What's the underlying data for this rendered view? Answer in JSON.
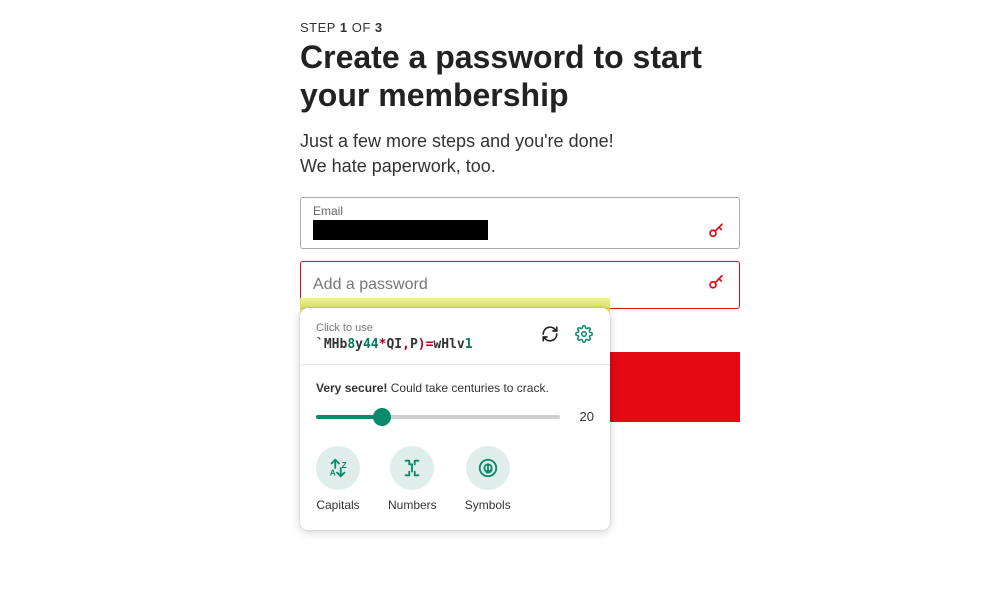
{
  "step": {
    "prefix": "STEP",
    "current": "1",
    "of_word": "OF",
    "total": "3"
  },
  "title_line1": "Create a password to start",
  "title_line2": "your membership",
  "subtitle_line1": "Just a few more steps and you're done!",
  "subtitle_line2": "We hate paperwork, too.",
  "email": {
    "label": "Email"
  },
  "password": {
    "placeholder": "Add a password"
  },
  "generator": {
    "click_label": "Click to use",
    "chars": [
      {
        "c": "`",
        "cls": "c-dk"
      },
      {
        "c": "M",
        "cls": "c-dk"
      },
      {
        "c": "H",
        "cls": "c-dk"
      },
      {
        "c": "b",
        "cls": "c-dk"
      },
      {
        "c": "8",
        "cls": "c-dg"
      },
      {
        "c": "y",
        "cls": "c-dk"
      },
      {
        "c": "4",
        "cls": "c-dg"
      },
      {
        "c": "4",
        "cls": "c-dg"
      },
      {
        "c": "*",
        "cls": "c-rd"
      },
      {
        "c": "Q",
        "cls": "c-dk"
      },
      {
        "c": "I",
        "cls": "c-dk"
      },
      {
        "c": ",",
        "cls": "c-rd"
      },
      {
        "c": "P",
        "cls": "c-dk"
      },
      {
        "c": ")",
        "cls": "c-rd"
      },
      {
        "c": "=",
        "cls": "c-rd"
      },
      {
        "c": "w",
        "cls": "c-dk"
      },
      {
        "c": "H",
        "cls": "c-dk"
      },
      {
        "c": "l",
        "cls": "c-dk"
      },
      {
        "c": "v",
        "cls": "c-dk"
      },
      {
        "c": "1",
        "cls": "c-dg"
      }
    ],
    "strength_bold": "Very secure!",
    "strength_rest": " Could take centuries to crack.",
    "length": "20",
    "toggles": {
      "capitals": "Capitals",
      "numbers": "Numbers",
      "symbols": "Symbols"
    }
  },
  "colors": {
    "accent_red": "#e50914",
    "accent_green": "#0a8a6a"
  }
}
